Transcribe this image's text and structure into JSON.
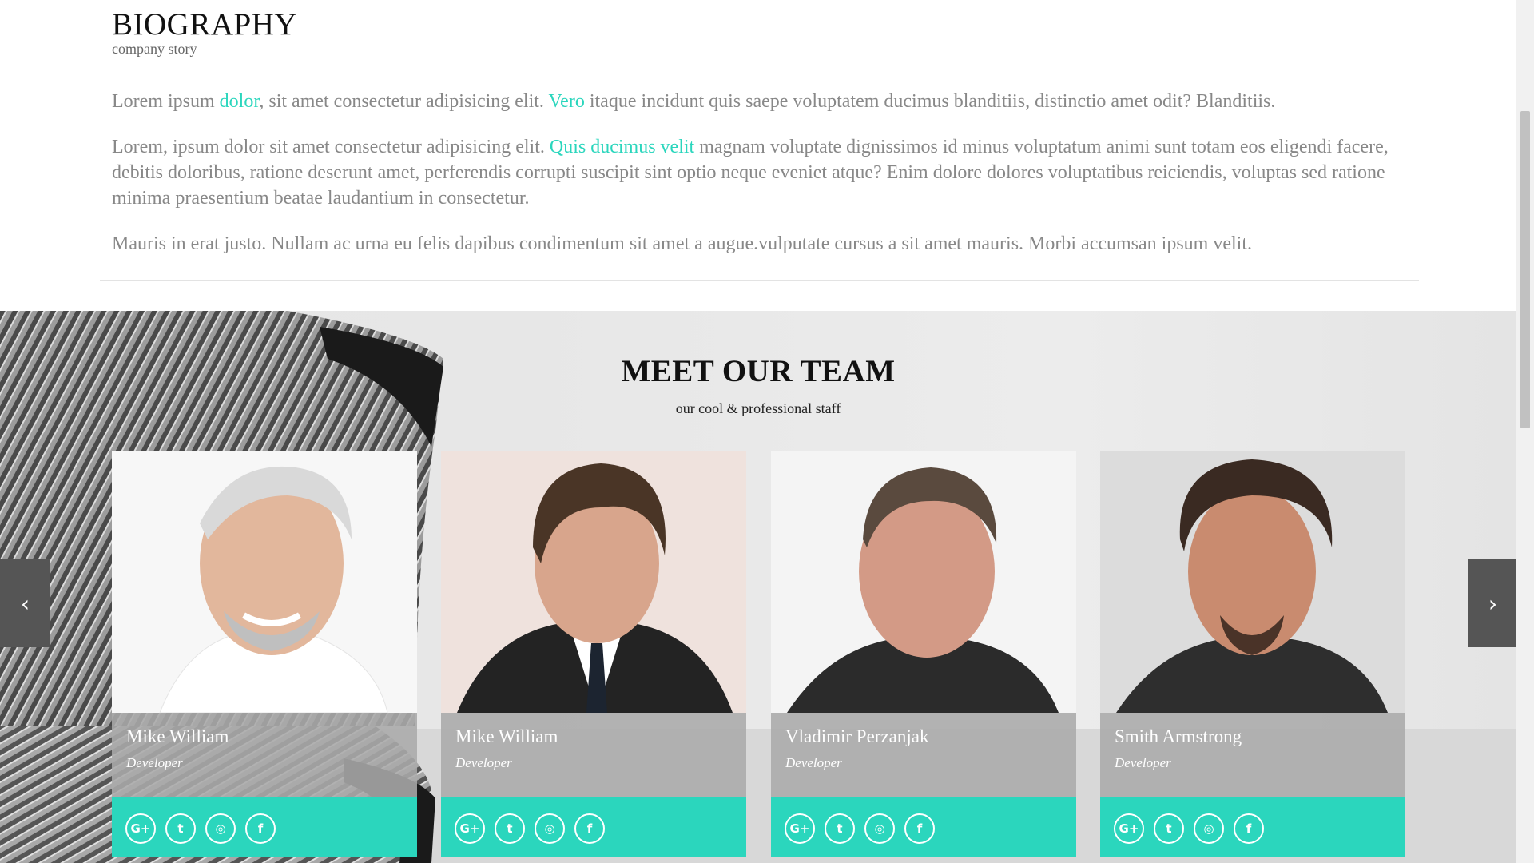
{
  "biography": {
    "title": "BIOGRAPHY",
    "subtitle": "company story",
    "p1": {
      "t1": "Lorem ipsum ",
      "link1": "dolor",
      "t2": ", sit amet consectetur adipisicing elit. ",
      "link2": "Vero",
      "t3": " itaque incidunt quis saepe voluptatem ducimus blanditiis, distinctio amet odit? Blanditiis."
    },
    "p2": {
      "t1": "Lorem, ipsum dolor sit amet consectetur adipisicing elit. ",
      "link1": "Quis ducimus velit",
      "t2": " magnam voluptate dignissimos id minus voluptatum animi sunt totam eos eligendi facere, debitis doloribus, ratione deserunt amet, perferendis corrupti suscipit sint optio neque eveniet atque? Enim dolore dolores voluptatibus reiciendis, voluptas sed ratione minima praesentium beatae laudantium in consectetur."
    },
    "p3": "Mauris in erat justo. Nullam ac urna eu felis dapibus condimentum sit amet a augue.vulputate cursus a sit amet mauris. Morbi accumsan ipsum velit."
  },
  "team": {
    "title": "MEET OUR TEAM",
    "subtitle": "our cool & professional staff",
    "prev_icon": "chevron-left-icon",
    "prev_glyph": "‹",
    "next_icon": "chevron-right-icon",
    "next_glyph": "›",
    "members": [
      {
        "name": "Mike William",
        "role": "Developer"
      },
      {
        "name": "Mike William",
        "role": "Developer"
      },
      {
        "name": "Vladimir Perzanjak",
        "role": "Developer"
      },
      {
        "name": "Smith Armstrong",
        "role": "Developer"
      }
    ],
    "social": {
      "google": "G+",
      "twitter": "t",
      "dribbble": "◎",
      "facebook": "f"
    }
  },
  "colors": {
    "accent": "#2bd6bd",
    "info_overlay": "#aaaaaa",
    "arrow_bg": "#555555"
  }
}
